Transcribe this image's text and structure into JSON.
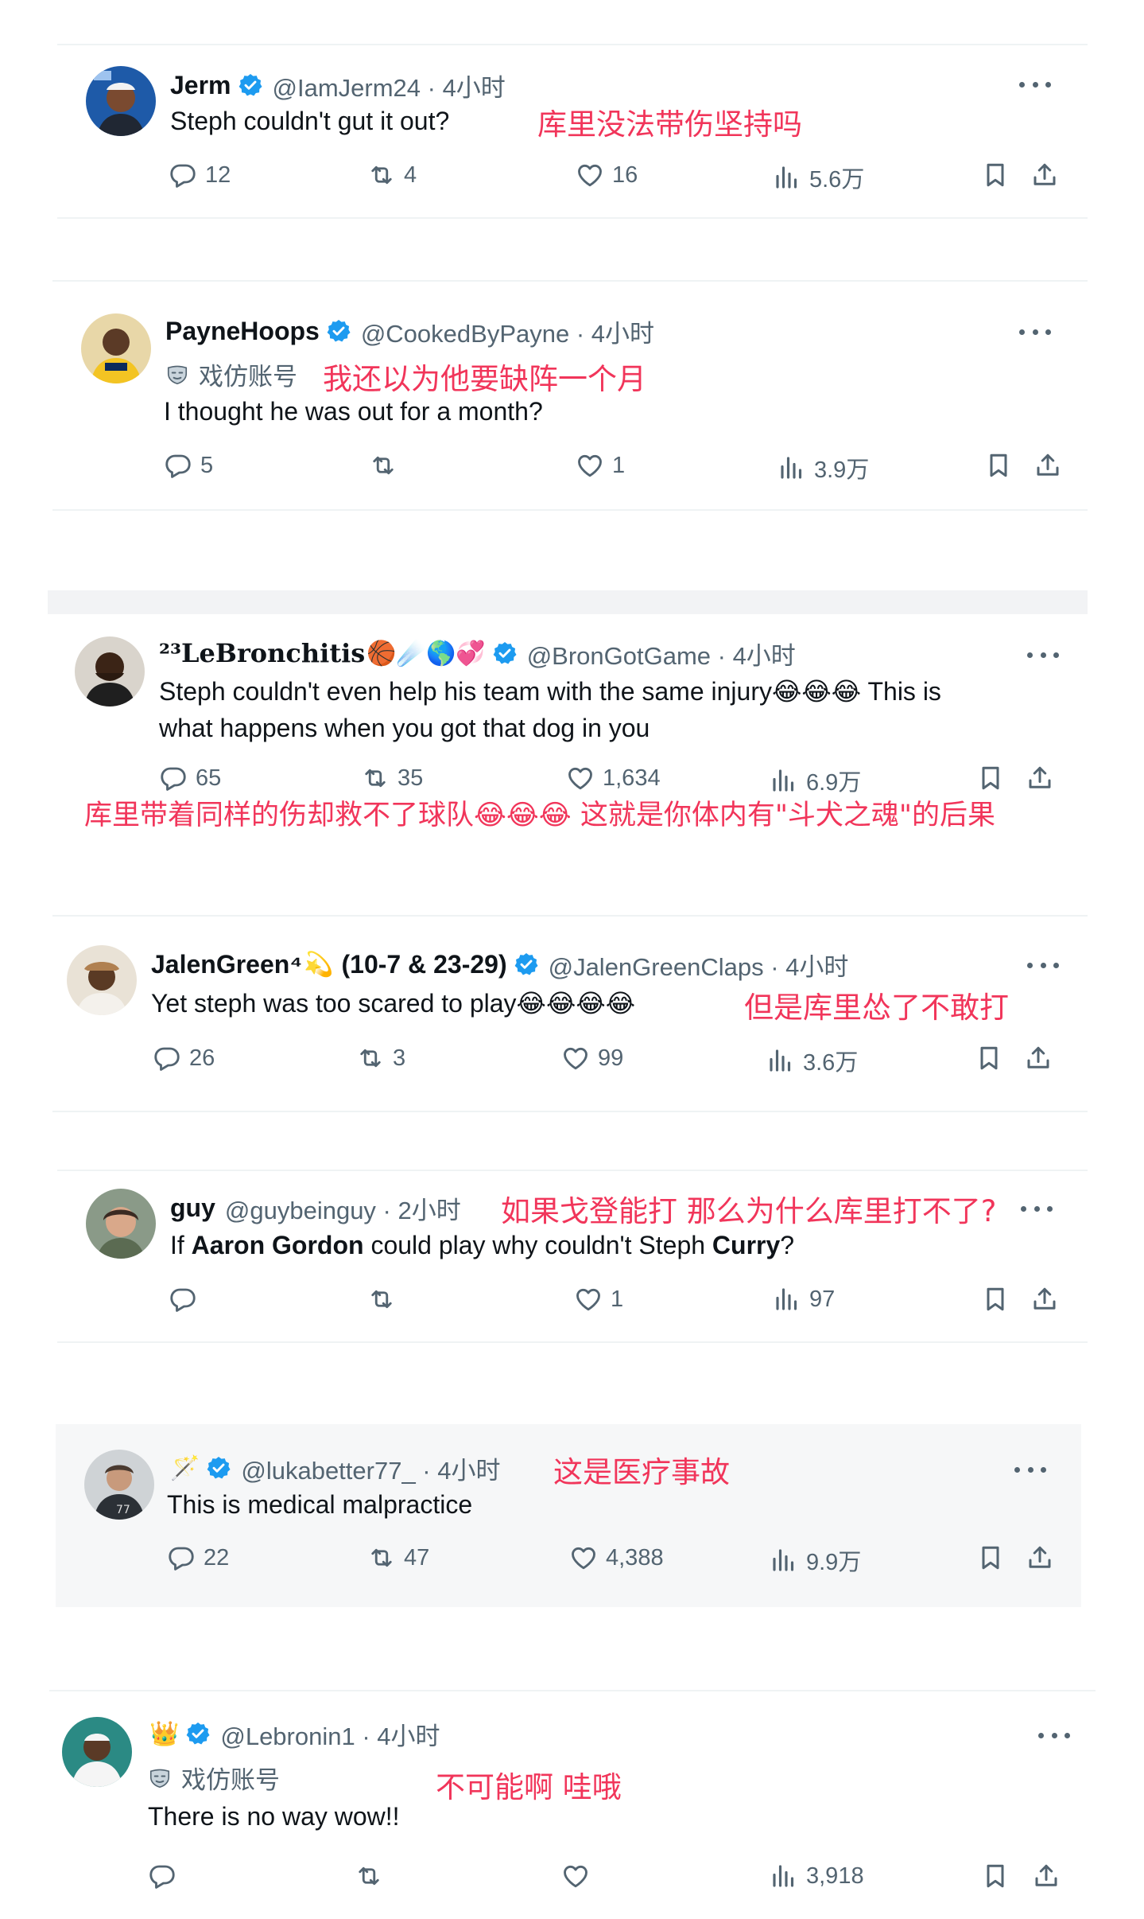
{
  "icons": {
    "reply": "reply-icon",
    "retweet": "retweet-icon",
    "like": "heart-icon",
    "views": "views-chart-icon",
    "bookmark": "bookmark-icon",
    "share": "share-icon",
    "more": "more-icon",
    "verified": "verified-badge-icon",
    "parody": "parody-mask-icon"
  },
  "colors": {
    "annotation": "#f1355a",
    "verified": "#1d9bf0",
    "muted": "#536471"
  },
  "tweets": [
    {
      "name": "Jerm",
      "meta": "@IamJerm24 · 4小时",
      "text": "Steph couldn't gut it out?",
      "translation": "库里没法带伤坚持吗",
      "replies": "12",
      "retweets": "4",
      "likes": "16",
      "views": "5.6万"
    },
    {
      "name": "PayneHoops",
      "meta": "@CookedByPayne · 4小时",
      "parody_label": "戏仿账号",
      "text": "I thought he was out for a month?",
      "translation": "我还以为他要缺阵一个月",
      "replies": "5",
      "retweets": "",
      "likes": "1",
      "views": "3.9万"
    },
    {
      "name": "²³LeBronchitis",
      "name_emoji": "🏀☄️🌎💞",
      "meta": "@BronGotGame · 4小时",
      "text_line1": "Steph couldn't even help his team with the same injury😂😂😂 This is",
      "text_line2": "what happens when you got that dog in you",
      "translation": "库里带着同样的伤却救不了球队😂😂😂 这就是你体内有\"斗犬之魂\"的后果",
      "replies": "65",
      "retweets": "35",
      "likes": "1,634",
      "views": "6.9万"
    },
    {
      "name": "JalenGreen⁴",
      "name_emoji": "💫",
      "name_suffix": "(10-7 & 23-29)",
      "meta": "@JalenGreenClaps · 4小时",
      "text": "Yet steph was too scared to play😂😂😂😂",
      "translation": "但是库里怂了不敢打",
      "replies": "26",
      "retweets": "3",
      "likes": "99",
      "views": "3.6万"
    },
    {
      "name": "guy",
      "meta": "@guybeinguy · 2小时",
      "text_prefix": "If ",
      "text_bold1": "Aaron Gordon",
      "text_mid": " could play why couldn't Steph ",
      "text_bold2": "Curry",
      "text_suffix": "?",
      "translation": "如果戈登能打 那么为什么库里打不了?",
      "replies": "",
      "retweets": "",
      "likes": "1",
      "views": "97"
    },
    {
      "name_emoji": "🪄",
      "meta": "@lukabetter77_ · 4小时",
      "text": "This is medical malpractice",
      "translation": "这是医疗事故",
      "replies": "22",
      "retweets": "47",
      "likes": "4,388",
      "views": "9.9万"
    },
    {
      "name_emoji": "👑",
      "meta": "@Lebronin1 · 4小时",
      "parody_label": "戏仿账号",
      "text": "There is no way wow!!",
      "translation": "不可能啊 哇哦",
      "replies": "",
      "retweets": "",
      "likes": "",
      "views": "3,918"
    }
  ]
}
